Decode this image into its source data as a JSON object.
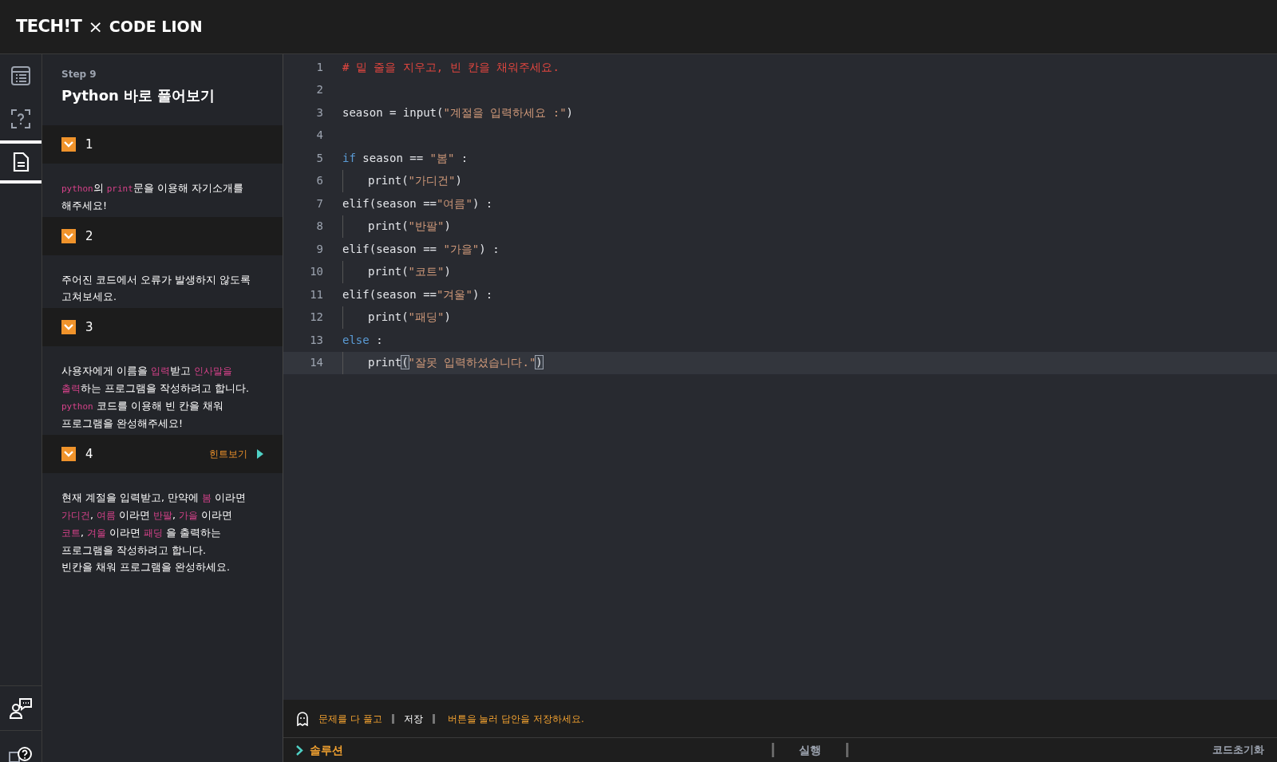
{
  "header": {
    "logo_left": "TECH!T",
    "separator": "×",
    "logo_right": "CODE LION"
  },
  "rail": {
    "items": [
      {
        "kind": "list",
        "selected": false
      },
      {
        "kind": "question",
        "selected": false
      },
      {
        "kind": "document",
        "selected": true
      }
    ],
    "bottom_items": [
      {
        "kind": "mentor"
      },
      {
        "kind": "help"
      }
    ]
  },
  "lesson": {
    "step": "Step 9",
    "title": "Python 바로 풀어보기",
    "tasks": [
      {
        "number": "1",
        "checked": true,
        "description": [
          {
            "text": "python",
            "kind": "code"
          },
          {
            "text": "의 ",
            "kind": "plain"
          },
          {
            "text": "print",
            "kind": "code"
          },
          {
            "text": "문을 이용해 자기소개를 해주세요!",
            "kind": "plain"
          }
        ]
      },
      {
        "number": "2",
        "checked": true,
        "description": [
          {
            "text": "주어진 코드에서 오류가 발생하지 않도록 고쳐보세요.",
            "kind": "plain"
          }
        ]
      },
      {
        "number": "3",
        "checked": true,
        "description": [
          {
            "text": "사용자에게 이름을 ",
            "kind": "plain"
          },
          {
            "text": "입력",
            "kind": "term"
          },
          {
            "text": "받고 ",
            "kind": "plain"
          },
          {
            "text": "인사말을 출력",
            "kind": "term"
          },
          {
            "text": "하는 프로그램을 작성하려고 합니다. ",
            "kind": "plain"
          },
          {
            "text": "python",
            "kind": "code"
          },
          {
            "text": " 코드를 이용해 빈 칸을 채워 프로그램을 완성해주세요!",
            "kind": "plain"
          }
        ]
      },
      {
        "number": "4",
        "checked": true,
        "hint": "힌트보기",
        "description": [
          {
            "text": "현재 계절을 입력받고, 만약에 ",
            "kind": "plain"
          },
          {
            "text": "봄",
            "kind": "term"
          },
          {
            "text": " 이라면 ",
            "kind": "plain"
          },
          {
            "text": "가디건",
            "kind": "term"
          },
          {
            "text": ", ",
            "kind": "plain"
          },
          {
            "text": "여름",
            "kind": "term"
          },
          {
            "text": " 이라면 ",
            "kind": "plain"
          },
          {
            "text": "반팔",
            "kind": "term"
          },
          {
            "text": ", ",
            "kind": "plain"
          },
          {
            "text": "가을",
            "kind": "term"
          },
          {
            "text": " 이라면 ",
            "kind": "plain"
          },
          {
            "text": "코트",
            "kind": "term"
          },
          {
            "text": ", ",
            "kind": "plain"
          },
          {
            "text": "겨울",
            "kind": "term"
          },
          {
            "text": " 이라면 ",
            "kind": "plain"
          },
          {
            "text": "패딩",
            "kind": "term"
          },
          {
            "text": " 을 출력하는 프로그램을 작성하려고 합니다.\n빈칸을 채워 프로그램을 완성하세요.",
            "kind": "plain"
          }
        ]
      }
    ]
  },
  "editor": {
    "lines": [
      {
        "number": "1",
        "indent": false,
        "current": false,
        "tokens": [
          {
            "kind": "comment",
            "text": "# 밑 줄을 지우고, 빈 칸을 채워주세요."
          }
        ]
      },
      {
        "number": "2",
        "indent": false,
        "current": false
      },
      {
        "number": "3",
        "indent": false,
        "current": false,
        "tokens": [
          {
            "kind": "plain",
            "text": "season = input("
          },
          {
            "kind": "string",
            "text": "\"계절을 입력하세요 :\""
          },
          {
            "kind": "plain",
            "text": ")"
          }
        ]
      },
      {
        "number": "4",
        "indent": false,
        "current": false
      },
      {
        "number": "5",
        "indent": false,
        "current": false,
        "tokens": [
          {
            "kind": "keyword",
            "text": "if"
          },
          {
            "kind": "plain",
            "text": " season == "
          },
          {
            "kind": "string",
            "text": "\"봄\""
          },
          {
            "kind": "plain",
            "text": " :"
          }
        ]
      },
      {
        "number": "6",
        "indent": true,
        "current": false,
        "tokens": [
          {
            "kind": "plain",
            "text": "print("
          },
          {
            "kind": "string",
            "text": "\"가디건\""
          },
          {
            "kind": "plain",
            "text": ")"
          }
        ]
      },
      {
        "number": "7",
        "indent": false,
        "current": false,
        "tokens": [
          {
            "kind": "plain",
            "text": "elif(season =="
          },
          {
            "kind": "string",
            "text": "\"여름\""
          },
          {
            "kind": "plain",
            "text": ") :"
          }
        ]
      },
      {
        "number": "8",
        "indent": true,
        "current": false,
        "tokens": [
          {
            "kind": "plain",
            "text": "print("
          },
          {
            "kind": "string",
            "text": "\"반팔\""
          },
          {
            "kind": "plain",
            "text": ")"
          }
        ]
      },
      {
        "number": "9",
        "indent": false,
        "current": false,
        "tokens": [
          {
            "kind": "plain",
            "text": "elif(season == "
          },
          {
            "kind": "string",
            "text": "\"가을\""
          },
          {
            "kind": "plain",
            "text": ") :"
          }
        ]
      },
      {
        "number": "10",
        "indent": true,
        "current": false,
        "tokens": [
          {
            "kind": "plain",
            "text": "print("
          },
          {
            "kind": "string",
            "text": "\"코트\""
          },
          {
            "kind": "plain",
            "text": ")"
          }
        ]
      },
      {
        "number": "11",
        "indent": false,
        "current": false,
        "tokens": [
          {
            "kind": "plain",
            "text": "elif(season =="
          },
          {
            "kind": "string",
            "text": "\"겨울\""
          },
          {
            "kind": "plain",
            "text": ") :"
          }
        ]
      },
      {
        "number": "12",
        "indent": true,
        "current": false,
        "tokens": [
          {
            "kind": "plain",
            "text": "print("
          },
          {
            "kind": "string",
            "text": "\"패딩\""
          },
          {
            "kind": "plain",
            "text": ")"
          }
        ]
      },
      {
        "number": "13",
        "indent": false,
        "current": false,
        "tokens": [
          {
            "kind": "keyword",
            "text": "else"
          },
          {
            "kind": "plain",
            "text": " :"
          }
        ]
      },
      {
        "number": "14",
        "indent": true,
        "current": true,
        "tokens": [
          {
            "kind": "plain",
            "text": "print"
          },
          {
            "kind": "bracket",
            "text": "("
          },
          {
            "kind": "string",
            "text": "\"잘못 입력하셨습니다.\""
          },
          {
            "kind": "bracket",
            "text": ")"
          }
        ]
      }
    ]
  },
  "notice": [
    {
      "text": "문제를 다 풀고",
      "kind": "accent"
    },
    {
      "text": "저장",
      "kind": "plain"
    },
    {
      "text": "버튼을 눌러 답안을 저장하세요.",
      "kind": "accent"
    }
  ],
  "bottom_bar": {
    "solution": "솔루션",
    "run": "실행",
    "reset": "코드초기화"
  }
}
